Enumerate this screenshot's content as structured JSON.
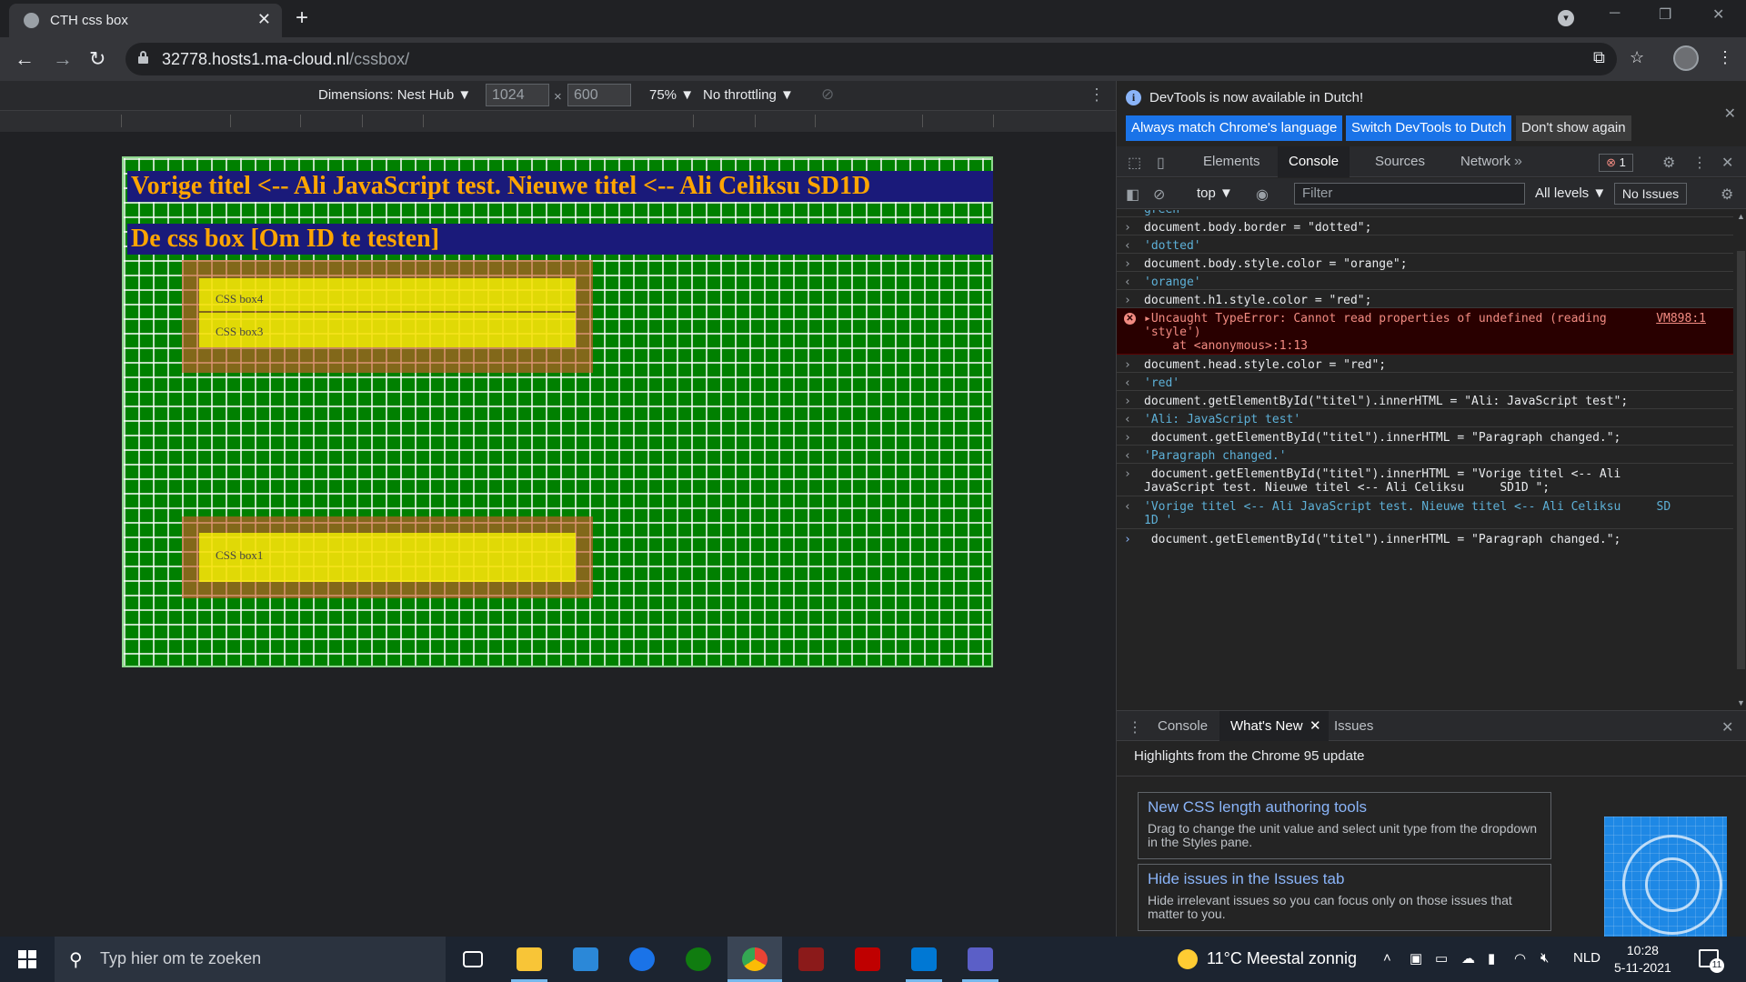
{
  "browser": {
    "tab_title": "CTH css box",
    "tab_close": "✕",
    "new_tab": "+",
    "url_host": "32778.hosts1.ma-cloud.nl",
    "url_path": "/cssbox/"
  },
  "device_toolbar": {
    "dimensions_label": "Dimensions: Nest Hub ▼",
    "width": "1024",
    "times": "×",
    "height": "600",
    "zoom": "75% ▼",
    "throttling": "No throttling ▼"
  },
  "page": {
    "title_h1": "Vorige titel <-- Ali JavaScript test. Nieuwe titel <-- Ali Celiksu SD1D",
    "subtitle_h1": "De css box [Om ID te testen]",
    "box4_label": "CSS box4",
    "box3_label": "CSS box3",
    "box1_label": "CSS box1"
  },
  "devtools": {
    "info_message": "DevTools is now available in Dutch!",
    "btn_match": "Always match Chrome's language",
    "btn_switch": "Switch DevTools to Dutch",
    "btn_dont_show": "Don't show again",
    "tabs": [
      "Elements",
      "Console",
      "Sources",
      "Network"
    ],
    "tabs_more": "»",
    "error_count": "1",
    "context": "top ▼",
    "filter_placeholder": "Filter",
    "levels": "All levels ▼",
    "no_issues": "No Issues"
  },
  "console": {
    "partial_top": "green",
    "lines": [
      {
        "kind": "cmd",
        "text": "document.body.border = \"dotted\";"
      },
      {
        "kind": "res",
        "text": "'dotted'"
      },
      {
        "kind": "cmd",
        "text": "document.body.style.color = \"orange\";"
      },
      {
        "kind": "res",
        "text": "'orange'"
      },
      {
        "kind": "cmd",
        "text": "document.h1.style.color = \"red\";"
      },
      {
        "kind": "err",
        "text": "▸Uncaught TypeError: Cannot read properties of undefined (reading\n'style')\n    at <anonymous>:1:13",
        "source": "VM898:1"
      },
      {
        "kind": "cmd",
        "text": "document.head.style.color = \"red\";"
      },
      {
        "kind": "res",
        "text": "'red'"
      },
      {
        "kind": "cmd",
        "text": "document.getElementById(\"titel\").innerHTML = \"Ali: JavaScript test\";"
      },
      {
        "kind": "res",
        "text": "'Ali: JavaScript test'"
      },
      {
        "kind": "cmd",
        "text": " document.getElementById(\"titel\").innerHTML = \"Paragraph changed.\";"
      },
      {
        "kind": "res",
        "text": "'Paragraph changed.'"
      },
      {
        "kind": "cmd",
        "text": " document.getElementById(\"titel\").innerHTML = \"Vorige titel <-- Ali\nJavaScript test. Nieuwe titel <-- Ali Celiksu     SD1D \";"
      },
      {
        "kind": "res",
        "text": "'Vorige titel <-- Ali JavaScript test. Nieuwe titel <-- Ali Celiksu     SD\n1D '"
      },
      {
        "kind": "prompt",
        "text": " document.getElementById(\"titel\").innerHTML = \"Paragraph changed.\";"
      }
    ]
  },
  "drawer": {
    "tabs": [
      "Console",
      "What's New",
      "Issues"
    ],
    "highlights": "Highlights from the Chrome 95 update",
    "cards": [
      {
        "title": "New CSS length authoring tools",
        "desc": "Drag to change the unit value and select unit type from the dropdown in the Styles pane."
      },
      {
        "title": "Hide issues in the Issues tab",
        "desc": "Hide irrelevant issues so you can focus only on those issues that matter to you."
      }
    ]
  },
  "taskbar": {
    "search_placeholder": "Typ hier om te zoeken",
    "weather": "11°C  Meestal zonnig",
    "language": "NLD",
    "time": "10:28",
    "date": "5-11-2021",
    "notif_count": "11"
  },
  "colors": {
    "accent": "#1a73e8",
    "page_green": "#008000",
    "heading_orange": "#ffa500",
    "heading_bg": "#1a1a7a"
  }
}
